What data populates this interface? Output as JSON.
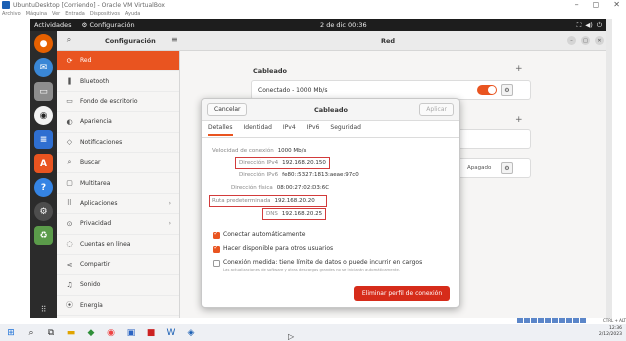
{
  "vbox": {
    "window_title": "UbuntuDesktop [Corriendo] - Oracle VM VirtualBox",
    "menu": [
      "Archivo",
      "Máquina",
      "Ver",
      "Entrada",
      "Dispositivos",
      "Ayuda"
    ],
    "controls": [
      "–",
      "◻",
      "✕"
    ],
    "host_key": "CTRL + ALT"
  },
  "topbar": {
    "activities": "Actividades",
    "app_label": "Configuración",
    "clock": "2 de dic 00:36"
  },
  "settings": {
    "header_title": "Configuración",
    "page_title": "Red",
    "sidebar": [
      {
        "icon": "⟳",
        "label": "Red",
        "active": true
      },
      {
        "icon": "❚",
        "label": "Bluetooth"
      },
      {
        "icon": "▭",
        "label": "Fondo de escritorio"
      },
      {
        "icon": "◐",
        "label": "Apariencia"
      },
      {
        "icon": "◇",
        "label": "Notificaciones"
      },
      {
        "icon": "⌕",
        "label": "Buscar"
      },
      {
        "icon": "▢",
        "label": "Multitarea"
      },
      {
        "icon": "⠿",
        "label": "Aplicaciones",
        "chevron": "›"
      },
      {
        "icon": "⊙",
        "label": "Privacidad",
        "chevron": "›"
      },
      {
        "icon": "◌",
        "label": "Cuentas en línea"
      },
      {
        "icon": "⋖",
        "label": "Compartir"
      },
      {
        "icon": "♫",
        "label": "Sonido"
      },
      {
        "icon": "⦿",
        "label": "Energía"
      }
    ],
    "main": {
      "wired_heading": "Cableado",
      "connected_label": "Conectado - 1000 Mb/s",
      "off_label": "Apagado"
    }
  },
  "dialog": {
    "cancel": "Cancelar",
    "title": "Cableado",
    "apply": "Aplicar",
    "tabs": [
      "Detalles",
      "Identidad",
      "IPv4",
      "IPv6",
      "Seguridad"
    ],
    "rows": [
      {
        "k": "Velocidad de conexión",
        "v": "1000 Mb/s"
      },
      {
        "k": "Dirección IPv4",
        "v": "192.168.20.150"
      },
      {
        "k": "Dirección IPv6",
        "v": "fe80::5327:1813:aeae:97c0"
      },
      {
        "k": "Dirección física",
        "v": "08:00:27:02:D3:6C"
      },
      {
        "k": "Ruta predeterminada",
        "v": "192.168.20.20"
      },
      {
        "k": "DNS",
        "v": "192.168.20.25"
      }
    ],
    "auto_connect": "Conectar automáticamente",
    "available_all": "Hacer disponible para otros usuarios",
    "metered": "Conexión medida: tiene límite de datos o puede incurrir en cargos",
    "metered_sub": "Las actualizaciones de software y otras descargas grandes no se iniciarán automáticamente.",
    "delete": "Eliminar perfil de conexión"
  },
  "taskbar": {
    "time": "12:36",
    "date": "2/12/2023"
  },
  "colors": {
    "accent": "#e95420",
    "highlight": "#d23b3b",
    "delete": "#d62c1a"
  }
}
